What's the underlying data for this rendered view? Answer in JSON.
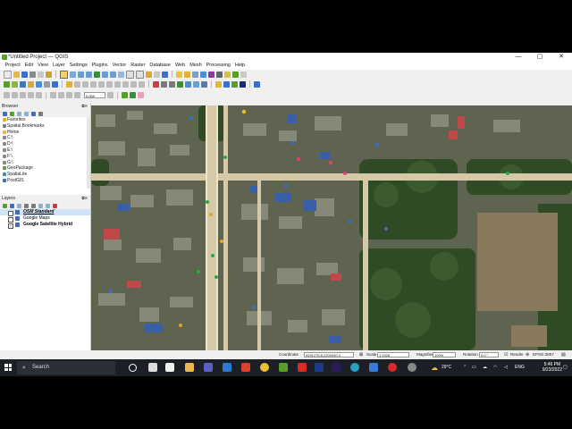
{
  "window": {
    "title": "*Untitled Project — QGIS",
    "controls": [
      "—",
      "▢",
      "✕"
    ]
  },
  "menu": [
    "Project",
    "Edit",
    "View",
    "Layer",
    "Settings",
    "Plugins",
    "Vector",
    "Raster",
    "Database",
    "Web",
    "Mesh",
    "Processing",
    "Help"
  ],
  "toolbar": {
    "scale_field": "0.000"
  },
  "browser": {
    "title": "Browser",
    "items": [
      {
        "label": "Favorites",
        "icon": "star-icon",
        "color": "#e8b400"
      },
      {
        "label": "Spatial Bookmarks",
        "icon": "bookmark-icon",
        "color": "#777777"
      },
      {
        "label": "Home",
        "icon": "folder-icon",
        "color": "#e6b84a"
      },
      {
        "label": "C:\\",
        "icon": "drive-icon",
        "color": "#888888"
      },
      {
        "label": "D:\\",
        "icon": "drive-icon",
        "color": "#888888"
      },
      {
        "label": "E:\\",
        "icon": "drive-icon",
        "color": "#888888"
      },
      {
        "label": "F:\\",
        "icon": "drive-icon",
        "color": "#888888"
      },
      {
        "label": "G:\\",
        "icon": "drive-icon",
        "color": "#888888"
      },
      {
        "label": "GeoPackage",
        "icon": "geopackage-icon",
        "color": "#6a9b3a"
      },
      {
        "label": "SpatiaLite",
        "icon": "spatialite-icon",
        "color": "#4a7fc0"
      },
      {
        "label": "PostGIS",
        "icon": "postgis-icon",
        "color": "#3d6fa3"
      }
    ]
  },
  "layers": {
    "title": "Layers",
    "items": [
      {
        "label": "OSM Standard",
        "checked": false,
        "style": "bold-italic-underline"
      },
      {
        "label": "Google Maps",
        "checked": false,
        "style": "normal"
      },
      {
        "label": "Google Satellite Hybrid",
        "checked": true,
        "style": "bold"
      }
    ]
  },
  "locator": {
    "placeholder": "Type to locate (Ctrl+K)"
  },
  "status": {
    "coordinate_label": "Coordinate",
    "coordinate": "9291276.8,2209430.4",
    "scale_label": "Scale",
    "scale": "1:1928",
    "magnifier_label": "Magnifier",
    "magnifier": "100%",
    "rotation_label": "Rotation",
    "rotation": "0.0 °",
    "render_label": "Render",
    "crs": "EPSG:3857"
  },
  "taskbar": {
    "search_label": "Search",
    "weather": "29°C",
    "language": "ENG",
    "time": "5:46 PM",
    "date": "9/23/2022"
  },
  "colors": {
    "qgis_green": "#5a9e2a",
    "taskbar": "#1c1f26",
    "road": "#d6c9a8",
    "vegetation": "#3a5a2a"
  }
}
